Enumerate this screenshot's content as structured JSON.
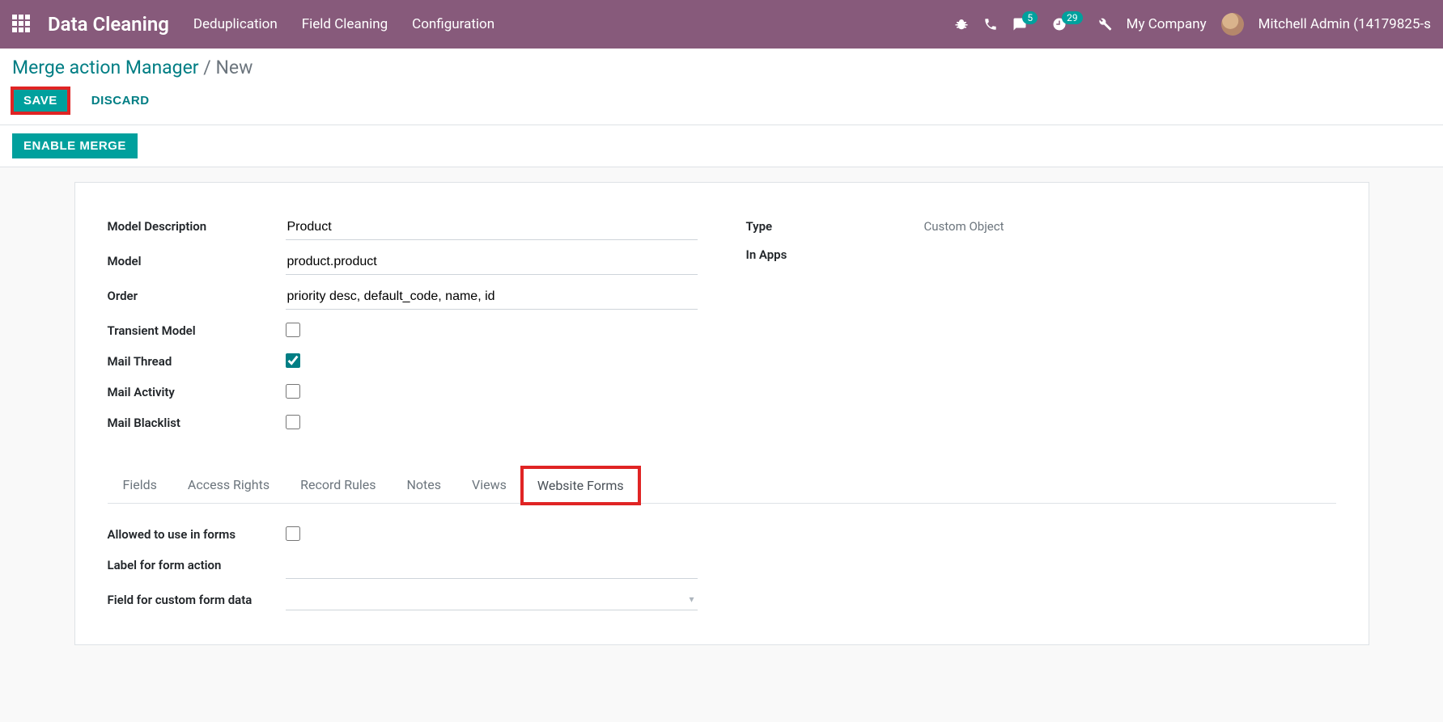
{
  "topbar": {
    "brand": "Data Cleaning",
    "nav": [
      "Deduplication",
      "Field Cleaning",
      "Configuration"
    ],
    "chat_badge": "5",
    "activity_badge": "29",
    "company": "My Company",
    "user": "Mitchell Admin (14179825-s"
  },
  "controlpanel": {
    "breadcrumb_root": "Merge action Manager",
    "breadcrumb_current": "New",
    "save_label": "SAVE",
    "discard_label": "DISCARD"
  },
  "statusbar": {
    "enable_merge_label": "ENABLE MERGE"
  },
  "form": {
    "labels": {
      "model_description": "Model Description",
      "model": "Model",
      "order": "Order",
      "transient_model": "Transient Model",
      "mail_thread": "Mail Thread",
      "mail_activity": "Mail Activity",
      "mail_blacklist": "Mail Blacklist",
      "type": "Type",
      "in_apps": "In Apps"
    },
    "values": {
      "model_description": "Product",
      "model": "product.product",
      "order": "priority desc, default_code, name, id",
      "type": "Custom Object"
    },
    "checks": {
      "transient_model": false,
      "mail_thread": true,
      "mail_activity": false,
      "mail_blacklist": false
    }
  },
  "tabs": [
    "Fields",
    "Access Rights",
    "Record Rules",
    "Notes",
    "Views",
    "Website Forms"
  ],
  "tabcontent": {
    "allowed_label": "Allowed to use in forms",
    "allowed_checked": false,
    "label_for_form_action": "Label for form action",
    "field_for_custom": "Field for custom form data"
  }
}
